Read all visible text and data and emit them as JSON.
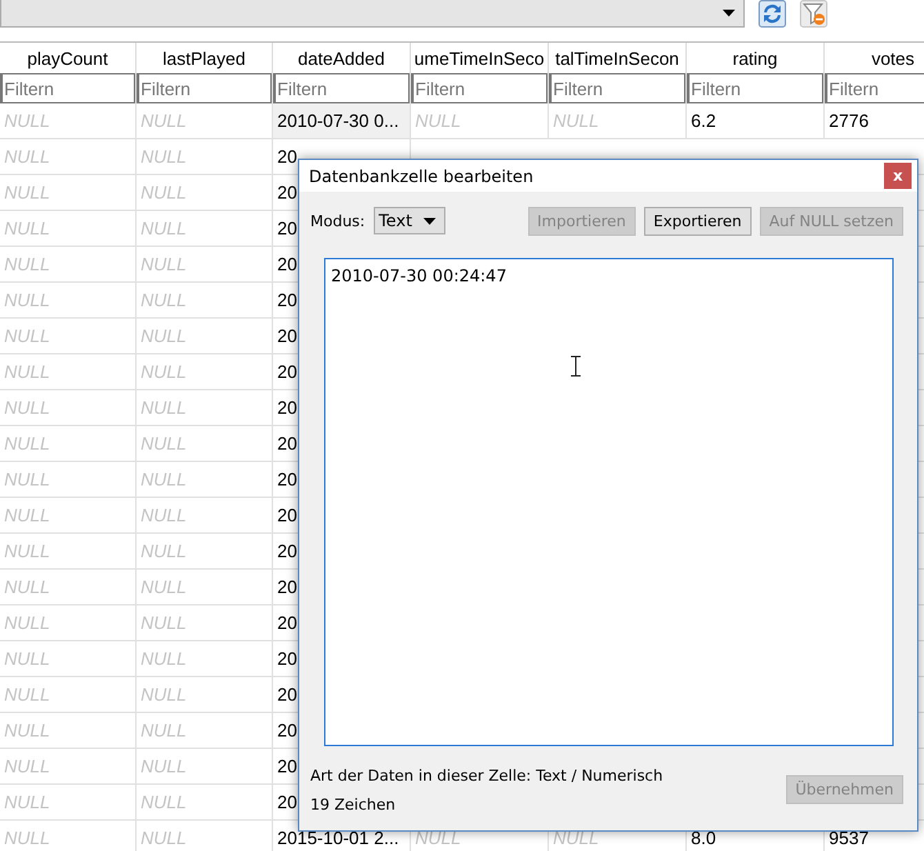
{
  "table": {
    "columns": [
      {
        "label": "playCount",
        "filter_placeholder": "Filtern"
      },
      {
        "label": "lastPlayed",
        "filter_placeholder": "Filtern"
      },
      {
        "label": "dateAdded",
        "filter_placeholder": "Filtern"
      },
      {
        "label": "umeTimeInSeco",
        "filter_placeholder": "Filtern"
      },
      {
        "label": "talTimeInSecon",
        "filter_placeholder": "Filtern"
      },
      {
        "label": "rating",
        "filter_placeholder": "Filtern"
      },
      {
        "label": "votes",
        "filter_placeholder": "Filtern"
      }
    ],
    "rows": [
      {
        "selected": true,
        "cells": [
          {
            "text": "NULL",
            "null": true
          },
          {
            "text": "NULL",
            "null": true
          },
          {
            "text": "2010-07-30 0...",
            "null": false
          },
          {
            "text": "NULL",
            "null": true
          },
          {
            "text": "NULL",
            "null": true
          },
          {
            "text": "6.2",
            "null": false
          },
          {
            "text": "2776",
            "null": false
          }
        ]
      },
      {
        "selected": false,
        "cells": [
          {
            "text": "NULL",
            "null": true
          },
          {
            "text": "NULL",
            "null": true
          },
          {
            "text": "20",
            "null": false
          }
        ]
      },
      {
        "selected": false,
        "cells": [
          {
            "text": "NULL",
            "null": true
          },
          {
            "text": "NULL",
            "null": true
          },
          {
            "text": "20",
            "null": false
          }
        ]
      },
      {
        "selected": false,
        "cells": [
          {
            "text": "NULL",
            "null": true
          },
          {
            "text": "NULL",
            "null": true
          },
          {
            "text": "20",
            "null": false
          }
        ]
      },
      {
        "selected": false,
        "cells": [
          {
            "text": "NULL",
            "null": true
          },
          {
            "text": "NULL",
            "null": true
          },
          {
            "text": "20",
            "null": false
          }
        ]
      },
      {
        "selected": false,
        "cells": [
          {
            "text": "NULL",
            "null": true
          },
          {
            "text": "NULL",
            "null": true
          },
          {
            "text": "20",
            "null": false
          }
        ]
      },
      {
        "selected": false,
        "cells": [
          {
            "text": "NULL",
            "null": true
          },
          {
            "text": "NULL",
            "null": true
          },
          {
            "text": "20",
            "null": false
          }
        ]
      },
      {
        "selected": false,
        "cells": [
          {
            "text": "NULL",
            "null": true
          },
          {
            "text": "NULL",
            "null": true
          },
          {
            "text": "20",
            "null": false
          }
        ]
      },
      {
        "selected": false,
        "cells": [
          {
            "text": "NULL",
            "null": true
          },
          {
            "text": "NULL",
            "null": true
          },
          {
            "text": "20",
            "null": false
          }
        ]
      },
      {
        "selected": false,
        "cells": [
          {
            "text": "NULL",
            "null": true
          },
          {
            "text": "NULL",
            "null": true
          },
          {
            "text": "20",
            "null": false
          }
        ]
      },
      {
        "selected": false,
        "cells": [
          {
            "text": "NULL",
            "null": true
          },
          {
            "text": "NULL",
            "null": true
          },
          {
            "text": "20",
            "null": false
          }
        ]
      },
      {
        "selected": false,
        "cells": [
          {
            "text": "NULL",
            "null": true
          },
          {
            "text": "NULL",
            "null": true
          },
          {
            "text": "20",
            "null": false
          }
        ]
      },
      {
        "selected": false,
        "cells": [
          {
            "text": "NULL",
            "null": true
          },
          {
            "text": "NULL",
            "null": true
          },
          {
            "text": "20",
            "null": false
          }
        ]
      },
      {
        "selected": false,
        "cells": [
          {
            "text": "NULL",
            "null": true
          },
          {
            "text": "NULL",
            "null": true
          },
          {
            "text": "20",
            "null": false
          }
        ]
      },
      {
        "selected": false,
        "cells": [
          {
            "text": "NULL",
            "null": true
          },
          {
            "text": "NULL",
            "null": true
          },
          {
            "text": "20",
            "null": false
          }
        ]
      },
      {
        "selected": false,
        "cells": [
          {
            "text": "NULL",
            "null": true
          },
          {
            "text": "NULL",
            "null": true
          },
          {
            "text": "20",
            "null": false
          }
        ]
      },
      {
        "selected": false,
        "cells": [
          {
            "text": "NULL",
            "null": true
          },
          {
            "text": "NULL",
            "null": true
          },
          {
            "text": "20",
            "null": false
          }
        ]
      },
      {
        "selected": false,
        "cells": [
          {
            "text": "NULL",
            "null": true
          },
          {
            "text": "NULL",
            "null": true
          },
          {
            "text": "20",
            "null": false
          }
        ]
      },
      {
        "selected": false,
        "cells": [
          {
            "text": "NULL",
            "null": true
          },
          {
            "text": "NULL",
            "null": true
          },
          {
            "text": "20",
            "null": false
          }
        ]
      },
      {
        "selected": false,
        "cells": [
          {
            "text": "NULL",
            "null": true
          },
          {
            "text": "NULL",
            "null": true
          },
          {
            "text": "20",
            "null": false
          }
        ]
      },
      {
        "selected": false,
        "cells": [
          {
            "text": "NULL",
            "null": true
          },
          {
            "text": "NULL",
            "null": true
          },
          {
            "text": "2015-10-01 2...",
            "null": false
          },
          {
            "text": "NULL",
            "null": true
          },
          {
            "text": "NULL",
            "null": true
          },
          {
            "text": "8.0",
            "null": false
          },
          {
            "text": "9537",
            "null": false
          }
        ]
      }
    ]
  },
  "dialog": {
    "title": "Datenbankzelle bearbeiten",
    "close": "x",
    "mode_label": "Modus:",
    "mode": "Text",
    "buttons": [
      {
        "label": "Importieren",
        "disabled": true
      },
      {
        "label": "Exportieren",
        "disabled": false
      },
      {
        "label": "Auf NULL setzen",
        "disabled": true
      }
    ],
    "value": "2010-07-30 00:24:47",
    "type_info": "Art der Daten in dieser Zelle: Text / Numerisch",
    "char_count": "19 Zeichen",
    "apply": {
      "label": "Übernehmen",
      "disabled": true
    }
  }
}
